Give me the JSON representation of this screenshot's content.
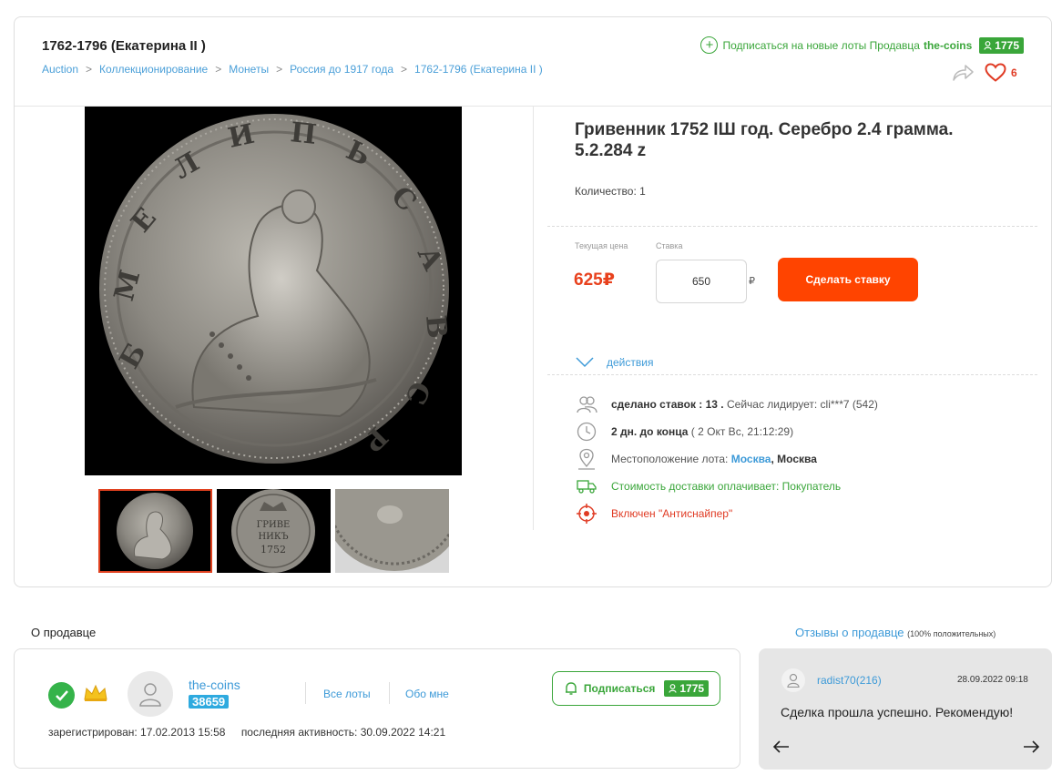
{
  "header": {
    "category_title": "1762-1796 (Екатерина II )",
    "breadcrumb": [
      "Auction",
      "Коллекционирование",
      "Монеты",
      "Россия до 1917 года",
      "1762-1796 (Екатерина II )"
    ],
    "breadcrumb_separator": ">",
    "subscribe_text": "Подписаться на новые лоты Продавца",
    "seller_name": "the-coins",
    "seller_rating": "1775",
    "favorites_count": "6"
  },
  "lot": {
    "title": "Гривенник 1752 IШ год. Серебро 2.4 грамма. 5.2.284 z",
    "quantity": "Количество: 1",
    "current_price_label": "Текущая цена",
    "current_price": "625₽",
    "bid_label": "Ставка",
    "bid_value": "650",
    "bid_currency": "₽",
    "bid_button": "Сделать ставку",
    "actions_label": "действия"
  },
  "info": {
    "bids_label": "сделано ставок : 13 .",
    "leader": "Сейчас лидирует: cli***7 (542)",
    "time_left": "2 дн. до конца",
    "end_time": "( 2 Окт Вс, 21:12:29)",
    "location_label": "Местоположение лота:",
    "location_city": "Москва",
    "location_region": ", Москва",
    "delivery": "Стоимость доставки оплачивает: Покупатель",
    "antisniper": "Включен \"Антиснайпер\""
  },
  "seller_section": {
    "title": "О продавце",
    "name": "the-coins",
    "score": "38659",
    "all_lots": "Все лоты",
    "about_me": "Обо мне",
    "subscribe_button": "Подписаться",
    "rating": "1775",
    "registered": "зарегистрирован: 17.02.2013 15:58",
    "last_activity": "последняя активность: 30.09.2022 14:21"
  },
  "reviews": {
    "title": "Отзывы о продавце",
    "positive": "(100% положительных)",
    "items": [
      {
        "user": "radist70(216)",
        "date": "28.09.2022 09:18",
        "text": "Сделка прошла успешно. Рекомендую!"
      }
    ]
  },
  "icons": {
    "plus": "plus-circle-icon",
    "share": "share-icon",
    "heart": "heart-icon",
    "users": "users-icon",
    "clock": "clock-icon",
    "location": "location-pin-icon",
    "truck": "truck-icon",
    "target": "target-icon",
    "check": "check-icon",
    "crown": "crown-icon",
    "bell": "bell-icon",
    "person": "person-icon"
  },
  "colors": {
    "accent_blue": "#3d9ad8",
    "green": "#3aa63a",
    "price_red": "#e8411d",
    "bid_button": "#ff4400"
  }
}
